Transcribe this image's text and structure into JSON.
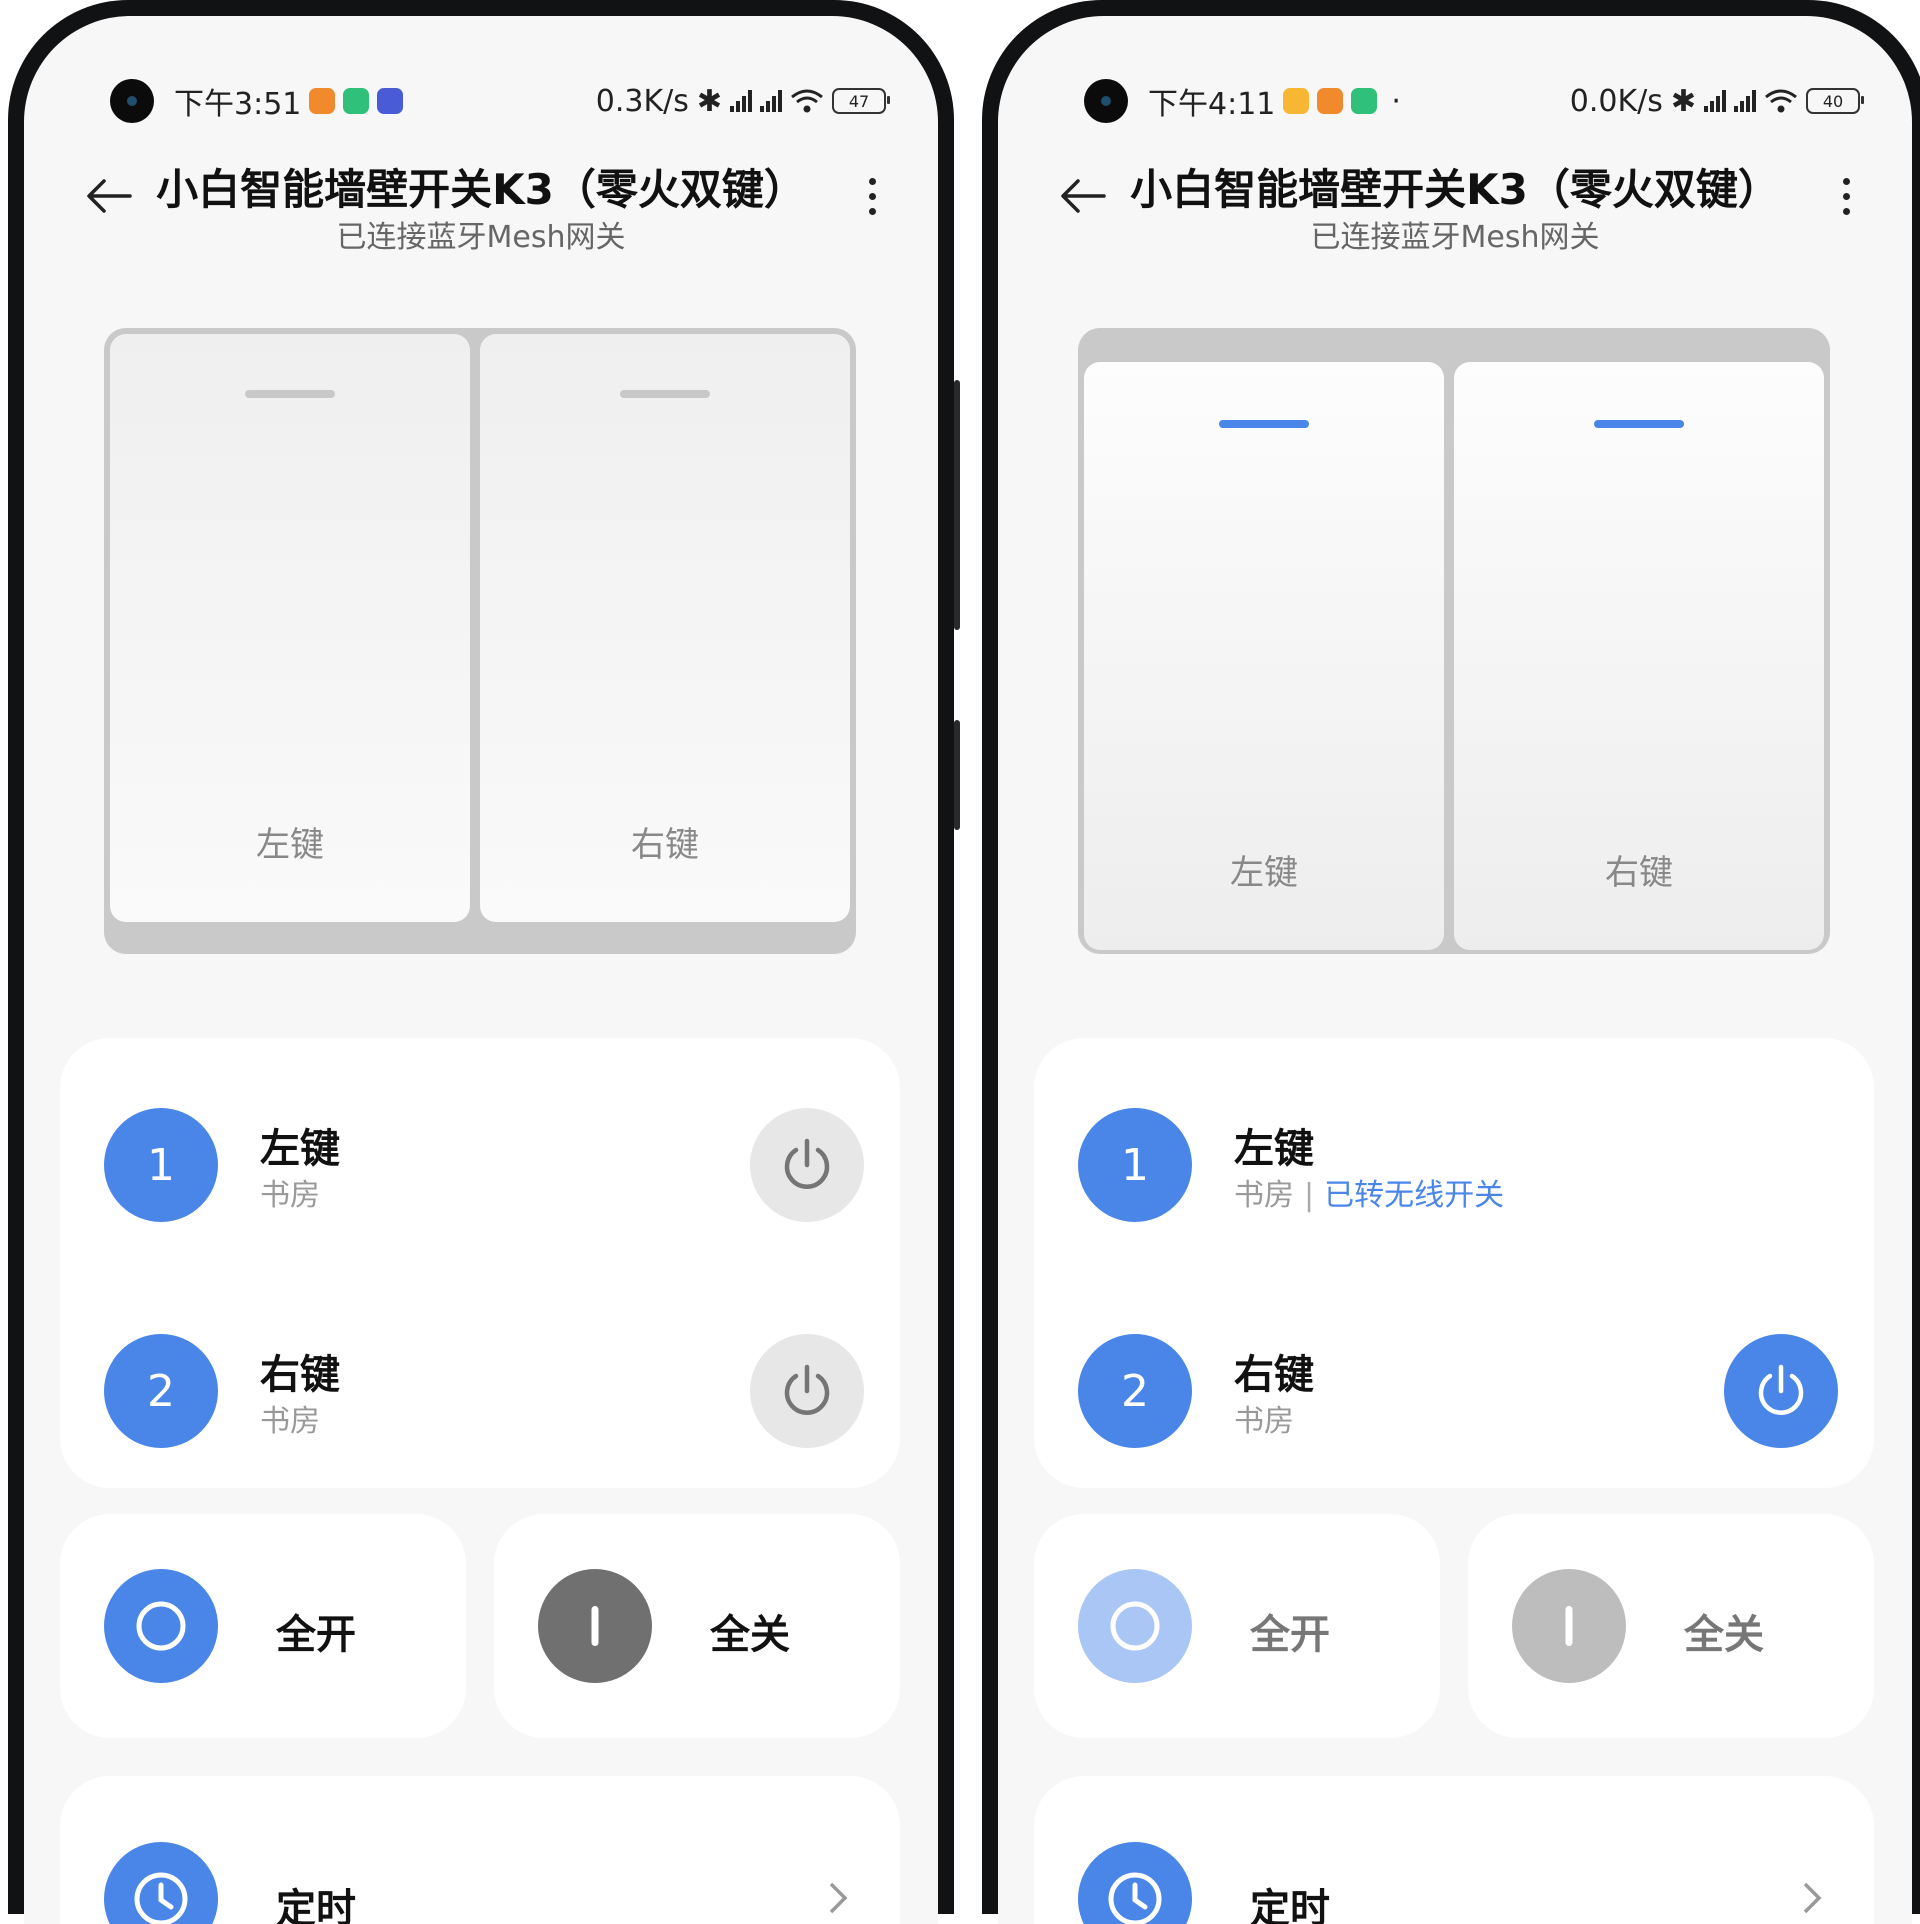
{
  "colors": {
    "accent": "#4a86e8",
    "accent_faded": "#a9c6f4",
    "off_gray": "#707070",
    "off_gray_faded": "#bdbdbd"
  },
  "screens": [
    {
      "status": {
        "time": "下午3:51",
        "net_speed": "0.3K/s",
        "battery": "47"
      },
      "header": {
        "title": "小白智能墙壁开关K3（零火双键）",
        "subtitle": "已连接蓝牙Mesh网关"
      },
      "panel": {
        "state": "off",
        "left_key": "左键",
        "right_key": "右键"
      },
      "rows": [
        {
          "num": "1",
          "name": "左键",
          "room": "书房",
          "tag": "",
          "power_on": false
        },
        {
          "num": "2",
          "name": "右键",
          "room": "书房",
          "tag": "",
          "power_on": false
        }
      ],
      "all_on_label": "全开",
      "all_off_label": "全关",
      "timer_label": "定时"
    },
    {
      "status": {
        "time": "下午4:11",
        "net_speed": "0.0K/s",
        "battery": "40"
      },
      "header": {
        "title": "小白智能墙壁开关K3（零火双键）",
        "subtitle": "已连接蓝牙Mesh网关"
      },
      "panel": {
        "state": "on",
        "left_key": "左键",
        "right_key": "右键"
      },
      "rows": [
        {
          "num": "1",
          "name": "左键",
          "room": "书房",
          "tag": "已转无线开关",
          "power_on": null
        },
        {
          "num": "2",
          "name": "右键",
          "room": "书房",
          "tag": "",
          "power_on": true
        }
      ],
      "all_on_label": "全开",
      "all_off_label": "全关",
      "timer_label": "定时"
    }
  ]
}
